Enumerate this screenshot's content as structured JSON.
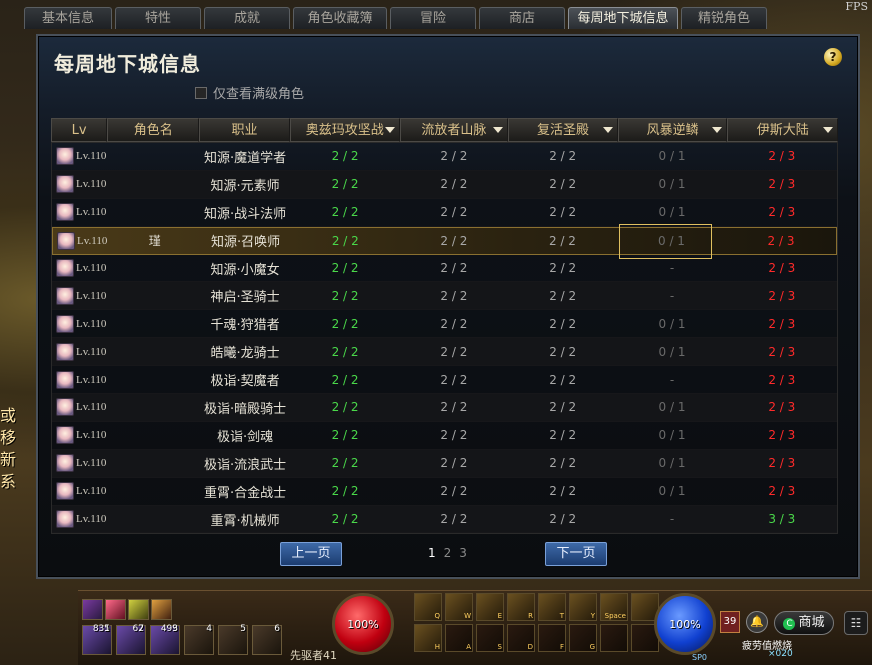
{
  "fps_label": "FPS",
  "side_text": "或移新系",
  "tabs": [
    {
      "label": "基本信息",
      "active": false
    },
    {
      "label": "特性",
      "active": false
    },
    {
      "label": "成就",
      "active": false
    },
    {
      "label": "角色收藏簿",
      "active": false
    },
    {
      "label": "冒险",
      "active": false
    },
    {
      "label": "商店",
      "active": false
    },
    {
      "label": "每周地下城信息",
      "active": true
    },
    {
      "label": "精锐角色",
      "active": false
    }
  ],
  "panel": {
    "title": "每周地下城信息",
    "help_label": "?",
    "filter_label": "仅查看满级角色"
  },
  "table": {
    "columns": [
      "Lv",
      "角色名",
      "职业",
      "奥兹玛攻坚战",
      "流放者山脉",
      "复活圣殿",
      "风暴逆鳞",
      "伊斯大陆"
    ],
    "rows": [
      {
        "lv": "Lv.110",
        "name": "",
        "job": "知源·魔道学者",
        "d1": "2 / 2",
        "d2": "2 / 2",
        "d3": "2 / 2",
        "d4": "0 / 1",
        "d5": "2 / 3",
        "d5_color": "red"
      },
      {
        "lv": "Lv.110",
        "name": "",
        "job": "知源·元素师",
        "d1": "2 / 2",
        "d2": "2 / 2",
        "d3": "2 / 2",
        "d4": "0 / 1",
        "d5": "2 / 3",
        "d5_color": "red"
      },
      {
        "lv": "Lv.110",
        "name": "",
        "job": "知源·战斗法师",
        "d1": "2 / 2",
        "d2": "2 / 2",
        "d3": "2 / 2",
        "d4": "0 / 1",
        "d5": "2 / 3",
        "d5_color": "red"
      },
      {
        "lv": "Lv.110",
        "name": "瑾",
        "job": "知源·召唤师",
        "d1": "2 / 2",
        "d2": "2 / 2",
        "d3": "2 / 2",
        "d4": "0 / 1",
        "d5": "2 / 3",
        "d5_color": "red",
        "selected": true
      },
      {
        "lv": "Lv.110",
        "name": "",
        "job": "知源·小魔女",
        "d1": "2 / 2",
        "d2": "2 / 2",
        "d3": "2 / 2",
        "d4": "-",
        "d5": "2 / 3",
        "d5_color": "red"
      },
      {
        "lv": "Lv.110",
        "name": "",
        "job": "神启·圣骑士",
        "d1": "2 / 2",
        "d2": "2 / 2",
        "d3": "2 / 2",
        "d4": "-",
        "d5": "2 / 3",
        "d5_color": "red"
      },
      {
        "lv": "Lv.110",
        "name": "",
        "job": "千魂·狩猎者",
        "d1": "2 / 2",
        "d2": "2 / 2",
        "d3": "2 / 2",
        "d4": "0 / 1",
        "d5": "2 / 3",
        "d5_color": "red"
      },
      {
        "lv": "Lv.110",
        "name": "",
        "job": "皓曦·龙骑士",
        "d1": "2 / 2",
        "d2": "2 / 2",
        "d3": "2 / 2",
        "d4": "0 / 1",
        "d5": "2 / 3",
        "d5_color": "red"
      },
      {
        "lv": "Lv.110",
        "name": "",
        "job": "极诣·契魔者",
        "d1": "2 / 2",
        "d2": "2 / 2",
        "d3": "2 / 2",
        "d4": "-",
        "d5": "2 / 3",
        "d5_color": "red"
      },
      {
        "lv": "Lv.110",
        "name": "",
        "job": "极诣·暗殿骑士",
        "d1": "2 / 2",
        "d2": "2 / 2",
        "d3": "2 / 2",
        "d4": "0 / 1",
        "d5": "2 / 3",
        "d5_color": "red"
      },
      {
        "lv": "Lv.110",
        "name": "",
        "job": "极诣·剑魂",
        "d1": "2 / 2",
        "d2": "2 / 2",
        "d3": "2 / 2",
        "d4": "0 / 1",
        "d5": "2 / 3",
        "d5_color": "red"
      },
      {
        "lv": "Lv.110",
        "name": "",
        "job": "极诣·流浪武士",
        "d1": "2 / 2",
        "d2": "2 / 2",
        "d3": "2 / 2",
        "d4": "0 / 1",
        "d5": "2 / 3",
        "d5_color": "red"
      },
      {
        "lv": "Lv.110",
        "name": "",
        "job": "重霄·合金战士",
        "d1": "2 / 2",
        "d2": "2 / 2",
        "d3": "2 / 2",
        "d4": "0 / 1",
        "d5": "2 / 3",
        "d5_color": "red"
      },
      {
        "lv": "Lv.110",
        "name": "",
        "job": "重霄·机械师",
        "d1": "2 / 2",
        "d2": "2 / 2",
        "d3": "2 / 2",
        "d4": "-",
        "d5": "3 / 3",
        "d5_color": "green"
      }
    ]
  },
  "pager": {
    "prev_label": "上一页",
    "next_label": "下一页",
    "pages": [
      "1",
      "2",
      "3"
    ],
    "current_page": "1"
  },
  "hud": {
    "consumables": [
      {
        "count": "835",
        "key": "1"
      },
      {
        "count": "67",
        "key": "2"
      },
      {
        "count": "499",
        "key": "3"
      },
      {
        "count": "",
        "key": "4"
      },
      {
        "count": "",
        "key": "5"
      },
      {
        "count": "",
        "key": "6"
      }
    ],
    "hp_label": "100%",
    "mp_label": "100%",
    "skill_keys": [
      "Q",
      "W",
      "E",
      "R",
      "T",
      "Y",
      "Space",
      "",
      "H",
      "A",
      "S",
      "D",
      "F",
      "G",
      "",
      ""
    ],
    "level_badge": "39",
    "shop_label": "商城",
    "shop_mark": "C",
    "menu_label": "☷",
    "bell_label": "🔔",
    "fatigue_text": "疲劳值燃烧",
    "fatigue_count": "×020",
    "sp_text": "SP0",
    "pioneer_text": "先驱者41",
    "accent_color": "#e0c060",
    "red_color": "#ff2a2a",
    "green_color": "#4ad84a"
  }
}
